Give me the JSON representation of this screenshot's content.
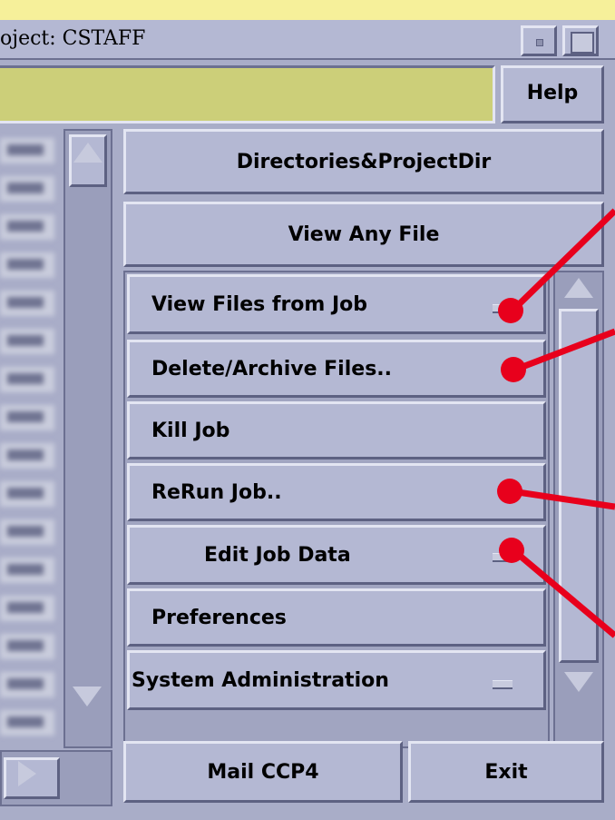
{
  "window": {
    "title": "oject: CSTAFF",
    "status_text": "",
    "help_label": "Help"
  },
  "menu": {
    "directories": "Directories&ProjectDir",
    "view_any_file": "View Any File",
    "view_files_from_job": "View Files from Job",
    "delete_archive": "Delete/Archive Files..",
    "kill_job": "Kill Job",
    "rerun_job": "ReRun Job..",
    "edit_job_data": "Edit Job Data",
    "preferences": "Preferences",
    "system_administration": "System Administration"
  },
  "bottom": {
    "mail_label": "Mail CCP4",
    "exit_label": "Exit"
  },
  "annotation_color": "#e8001c",
  "icons": [
    "scroll-up-icon",
    "scroll-down-icon",
    "scroll-right-icon",
    "cascade-dash-icon"
  ]
}
